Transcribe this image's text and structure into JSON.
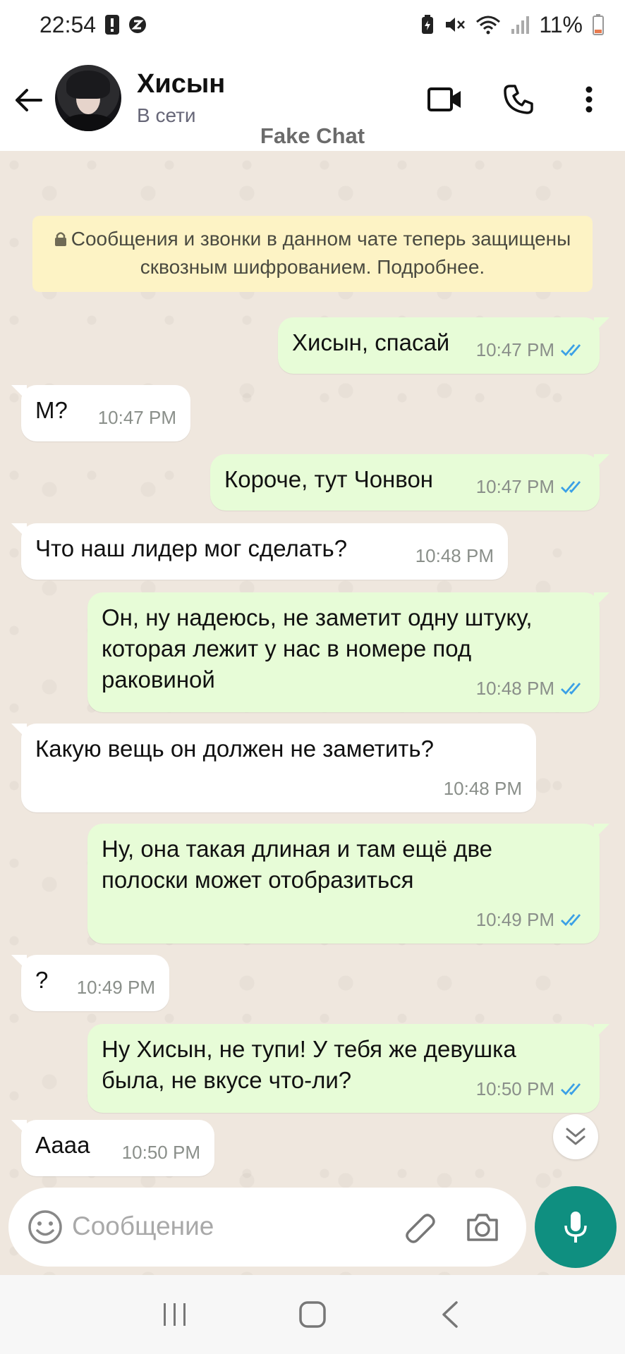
{
  "status_bar": {
    "time": "22:54",
    "battery": "11%"
  },
  "header": {
    "contact_name": "Хисын",
    "contact_status": "В сети",
    "watermark": "Fake Chat"
  },
  "chat": {
    "encryption_notice": "Сообщения и звонки в данном чате теперь защищены сквозным шифрованием. Подробнее.",
    "messages": [
      {
        "direction": "out",
        "text": "Хисын, спасай",
        "time": "10:47 PM"
      },
      {
        "direction": "in",
        "text": "М?",
        "time": "10:47 PM"
      },
      {
        "direction": "out",
        "text": "Короче, тут Чонвон",
        "time": "10:47 PM"
      },
      {
        "direction": "in",
        "text": "Что наш лидер мог сделать?",
        "time": "10:48 PM"
      },
      {
        "direction": "out",
        "text": "Он, ну надеюсь, не заметит одну штуку, которая лежит у нас в номере под раковиной",
        "time": "10:48 PM"
      },
      {
        "direction": "in",
        "text": "Какую вещь он должен не заметить?",
        "time": "10:48 PM"
      },
      {
        "direction": "out",
        "text": "Ну, она такая длиная и там ещё две полоски может отобразиться",
        "time": "10:49 PM"
      },
      {
        "direction": "in",
        "text": "?",
        "time": "10:49 PM"
      },
      {
        "direction": "out",
        "text": "Ну Хисын, не тупи! У тебя же девушка была, не вкусе что-ли?",
        "time": "10:50 PM"
      },
      {
        "direction": "in",
        "text": "Аааа",
        "time": "10:50 PM"
      }
    ]
  },
  "composer": {
    "placeholder": "Сообщение"
  },
  "colors": {
    "outgoing_bubble": "#e7fcd7",
    "incoming_bubble": "#ffffff",
    "accent": "#0f8f80",
    "read_ticks": "#3ba0e6"
  }
}
